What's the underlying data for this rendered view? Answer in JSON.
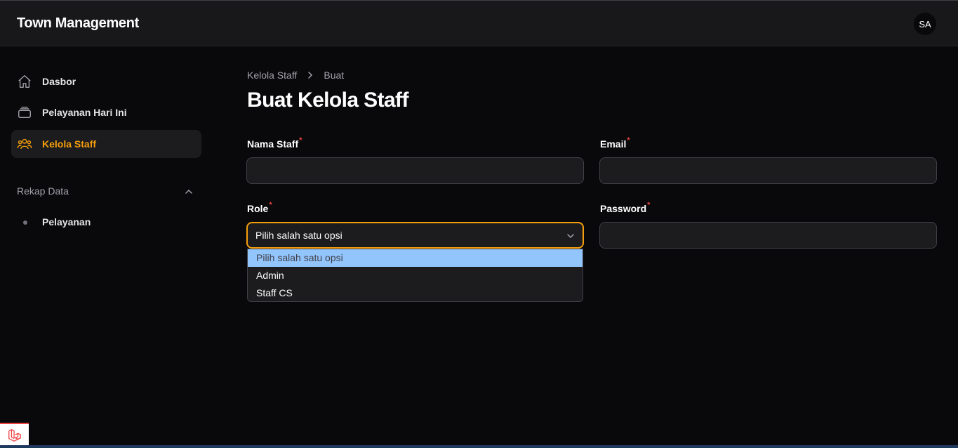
{
  "app": {
    "title": "Town Management",
    "user_initials": "SA"
  },
  "sidebar": {
    "items": [
      {
        "label": "Dasbor",
        "icon": "home-icon",
        "active": false
      },
      {
        "label": "Pelayanan Hari Ini",
        "icon": "stack-icon",
        "active": false
      },
      {
        "label": "Kelola Staff",
        "icon": "users-icon",
        "active": true
      }
    ],
    "group": {
      "label": "Rekap Data",
      "expanded": true,
      "items": [
        {
          "label": "Pelayanan"
        }
      ]
    }
  },
  "breadcrumb": {
    "parent": "Kelola Staff",
    "current": "Buat"
  },
  "page": {
    "title": "Buat Kelola Staff"
  },
  "form": {
    "nama_staff": {
      "label": "Nama Staff",
      "required_mark": "*",
      "value": ""
    },
    "email": {
      "label": "Email",
      "required_mark": "*",
      "value": ""
    },
    "role": {
      "label": "Role",
      "required_mark": "*",
      "value": "Pilih salah satu opsi",
      "options": [
        "Pilih salah satu opsi",
        "Admin",
        "Staff CS"
      ],
      "highlighted_option": "Pilih salah satu opsi",
      "open": true
    },
    "password": {
      "label": "Password",
      "required_mark": "*",
      "value": ""
    }
  },
  "colors": {
    "accent": "#f59e0b",
    "required": "#ef4444",
    "highlight": "#93c5fd",
    "background": "#09090b",
    "surface": "#18181b"
  }
}
